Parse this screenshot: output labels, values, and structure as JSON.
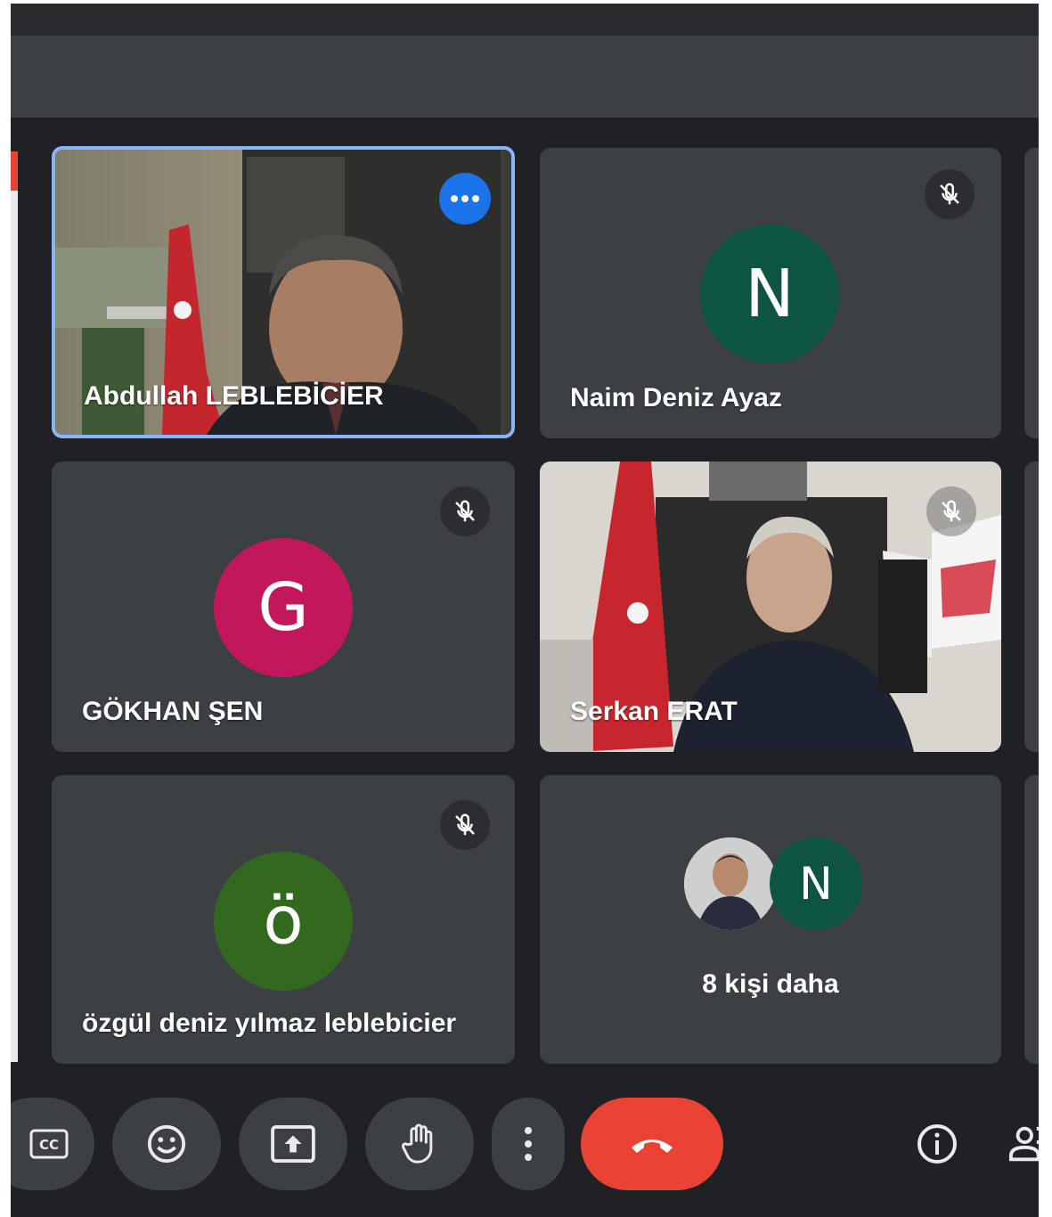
{
  "meeting": {
    "accent_color": "#8ab4f8",
    "end_call_color": "#ea4335"
  },
  "tiles": {
    "t1": {
      "name": "Abdullah LEBLEBİCİER",
      "type": "video",
      "highlighted": true
    },
    "t2": {
      "name": "Naim Deniz Ayaz",
      "initial": "N",
      "avatar_color": "#0d5443",
      "muted": true
    },
    "t3": {
      "name": "GÖKHAN ŞEN",
      "initial": "G",
      "avatar_color": "#c2185b",
      "muted": true
    },
    "t4": {
      "name": "Serkan ERAT",
      "type": "video",
      "muted": true
    },
    "t5": {
      "name": "özgül deniz yılmaz leblebicier",
      "initial": "ö",
      "avatar_color": "#33691e",
      "muted": true
    },
    "t6": {
      "more_label": "8 kişi daha",
      "initial": "N",
      "avatar_color": "#0d5443"
    }
  },
  "controls": {
    "icons": [
      "closed-captions-icon",
      "emoji-icon",
      "present-screen-icon",
      "raise-hand-icon",
      "more-options-icon",
      "end-call-icon",
      "info-icon",
      "people-icon"
    ]
  }
}
